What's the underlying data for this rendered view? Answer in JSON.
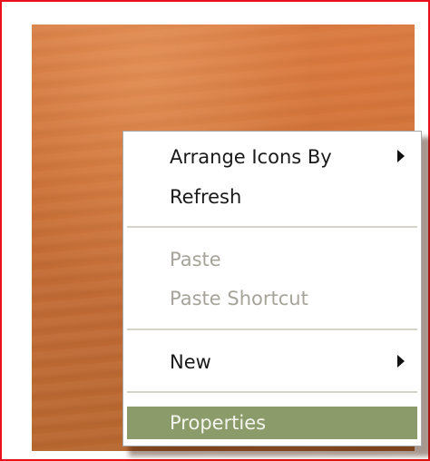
{
  "context_menu": {
    "items": [
      {
        "label": "Arrange Icons By",
        "submenu": true,
        "enabled": true
      },
      {
        "label": "Refresh",
        "submenu": false,
        "enabled": true
      },
      {
        "label": "Paste",
        "submenu": false,
        "enabled": false
      },
      {
        "label": "Paste Shortcut",
        "submenu": false,
        "enabled": false
      },
      {
        "label": "New",
        "submenu": true,
        "enabled": true
      },
      {
        "label": "Properties",
        "submenu": false,
        "enabled": true,
        "highlighted": true
      }
    ],
    "icons": {
      "submenu": "chevron-right-icon"
    }
  },
  "colors": {
    "frame_border": "#e8101a",
    "desktop": "#c96e34",
    "highlight": "#8b9b6a",
    "disabled_text": "#a6a39a"
  }
}
